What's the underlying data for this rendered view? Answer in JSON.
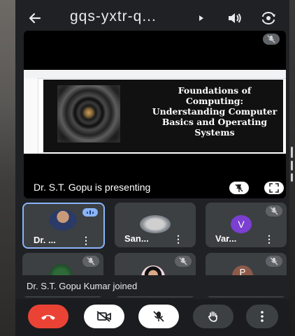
{
  "app": {
    "meeting_code": "gqs-yxtr-q...",
    "colors": {
      "background": "#202124",
      "tile": "#3c4043",
      "end_call": "#ea4335",
      "active_border": "#8ab4f8",
      "avatar_purple": "#7b3fd1"
    }
  },
  "topbar": {
    "back_icon": "arrow-back-icon",
    "caret_icon": "caret-right-icon",
    "audio_icon": "speaker-icon",
    "camera_switch_icon": "switch-camera-icon"
  },
  "presentation": {
    "slide_title": "Foundations of Computing: Understanding Computer Basics and Operating Systems",
    "presenting_label": "Dr. S.T. Gopu is presenting"
  },
  "participants": [
    {
      "name": "Dr. ...",
      "speaking": true,
      "avatar": "photo"
    },
    {
      "name": "San...",
      "speaking": false,
      "avatar": "photo"
    },
    {
      "name": "Var...",
      "speaking": false,
      "avatar": "initial",
      "initial": "V"
    },
    {
      "name": "",
      "speaking": false,
      "avatar": "photo"
    },
    {
      "name": "",
      "speaking": false,
      "avatar": "photo"
    },
    {
      "name": "",
      "speaking": false,
      "avatar": "initial",
      "initial": "P"
    }
  ],
  "toast": {
    "text": "Dr. S.T. Gopu Kumar joined"
  },
  "controls": {
    "end_call": "end-call-icon",
    "camera": "camera-off-icon",
    "mic": "mic-off-icon",
    "hand": "raise-hand-icon",
    "more": "more-vert-icon"
  }
}
